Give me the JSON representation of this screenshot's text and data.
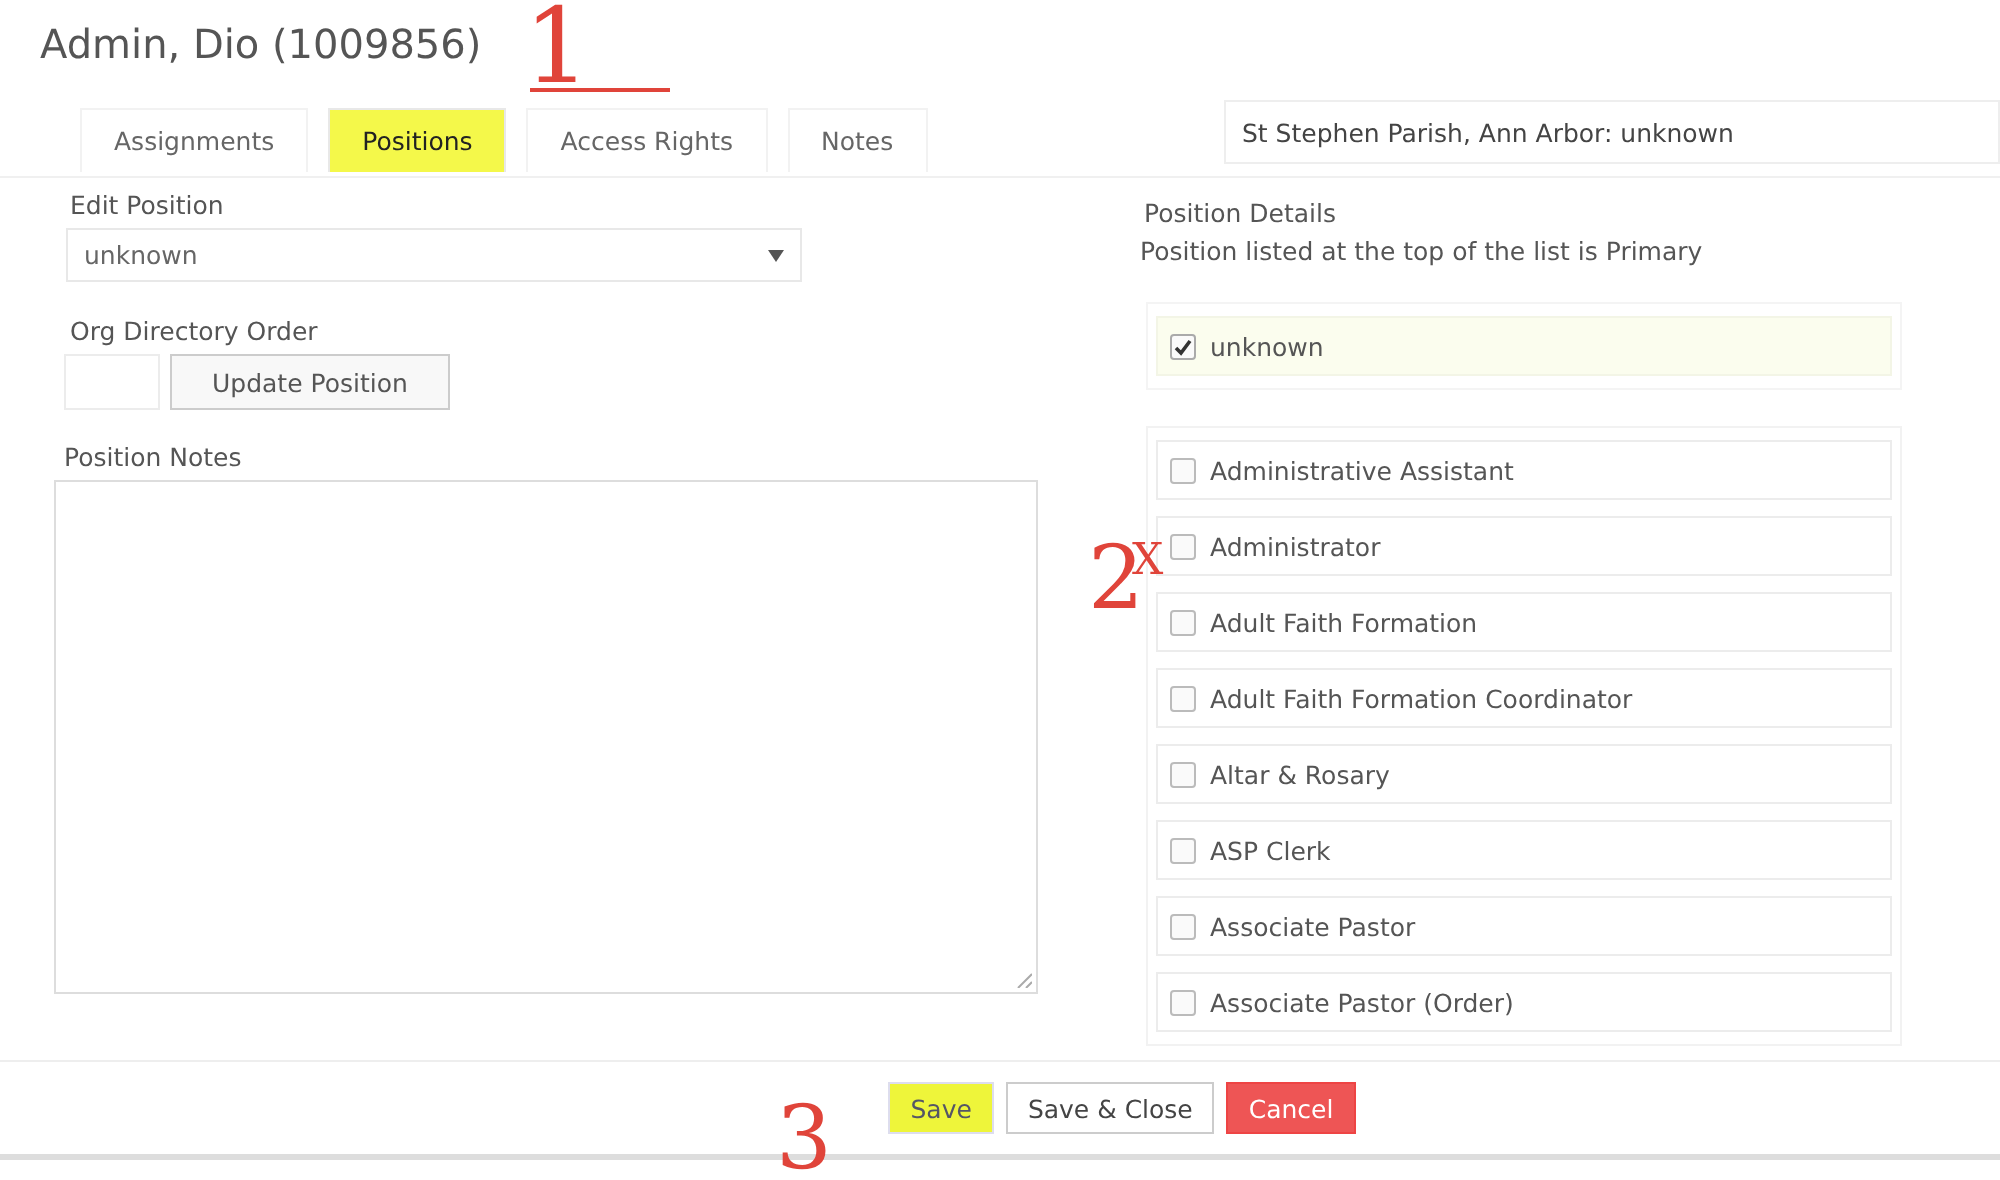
{
  "title": "Admin, Dio (1009856)",
  "tabs": [
    {
      "label": "Assignments",
      "selected": false,
      "highlighted": false
    },
    {
      "label": "Positions",
      "selected": true,
      "highlighted": true
    },
    {
      "label": "Access Rights",
      "selected": false,
      "highlighted": false
    },
    {
      "label": "Notes",
      "selected": false,
      "highlighted": false
    }
  ],
  "location": {
    "value": "St Stephen Parish, Ann Arbor: unknown"
  },
  "edit_position": {
    "label": "Edit Position",
    "value": "unknown"
  },
  "org_directory_order": {
    "label": "Org Directory Order",
    "button": "Update Position"
  },
  "position_notes": {
    "label": "Position Notes"
  },
  "position_details": {
    "title": "Position Details",
    "subtitle": "Position listed at the top of the list is Primary",
    "primary": [
      {
        "label": "unknown",
        "checked": true
      }
    ],
    "positions": [
      {
        "label": "Administrative Assistant",
        "checked": false
      },
      {
        "label": "Administrator",
        "checked": false
      },
      {
        "label": "Adult Faith Formation",
        "checked": false
      },
      {
        "label": "Adult Faith Formation Coordinator",
        "checked": false
      },
      {
        "label": "Altar & Rosary",
        "checked": false
      },
      {
        "label": "ASP Clerk",
        "checked": false
      },
      {
        "label": "Associate Pastor",
        "checked": false
      },
      {
        "label": "Associate Pastor (Order)",
        "checked": false
      }
    ]
  },
  "buttons": [
    {
      "label": "Save",
      "kind": "highlighted"
    },
    {
      "label": "Save & Close",
      "kind": "default"
    },
    {
      "label": "Cancel",
      "kind": "danger"
    }
  ],
  "annotations": [
    {
      "text": "1"
    },
    {
      "text": "2"
    },
    {
      "text": "X"
    },
    {
      "text": "3"
    }
  ]
}
